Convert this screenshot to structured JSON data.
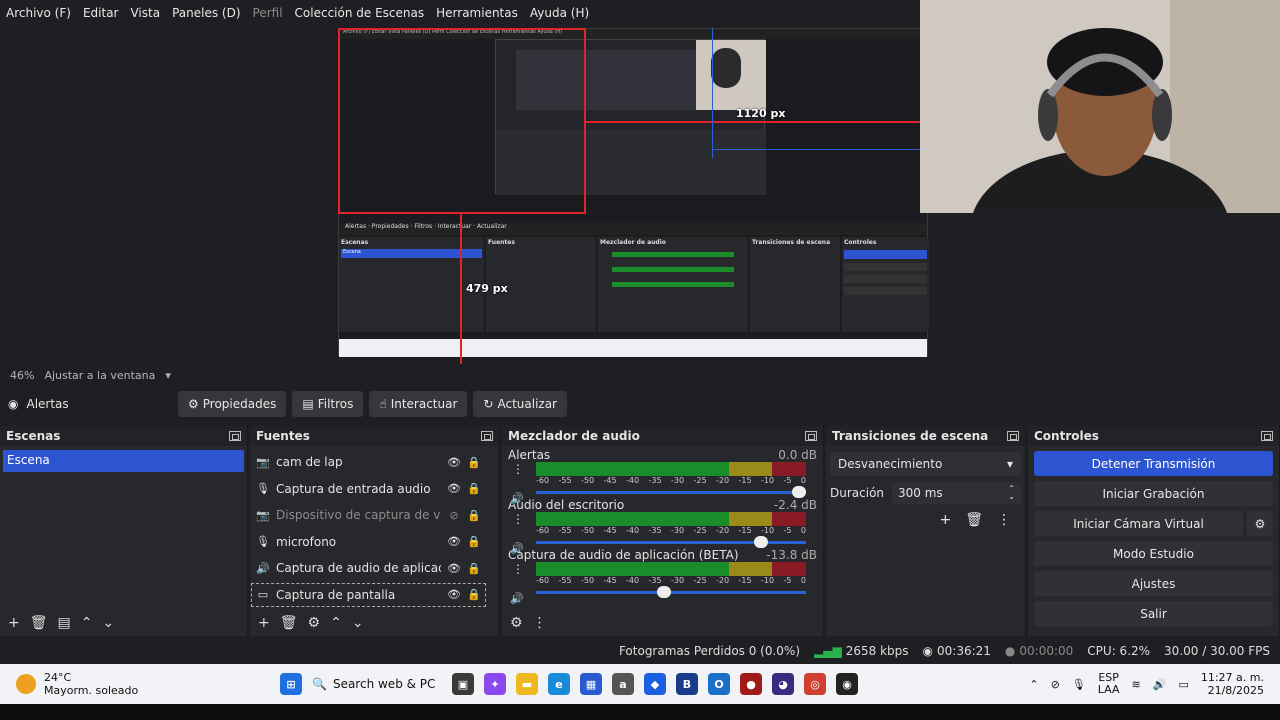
{
  "menu": [
    "Archivo (F)",
    "Editar",
    "Vista",
    "Paneles (D)",
    "Perfil",
    "Colección de Escenas",
    "Herramientas",
    "Ayuda (H)"
  ],
  "menu_disabled": [
    "Perfil"
  ],
  "preview": {
    "measure_h": "1120 px",
    "measure_v": "479 px"
  },
  "zoom": {
    "percent": "46%",
    "label": "Ajustar a la ventana"
  },
  "source_toolbar": {
    "source_name": "Alertas",
    "properties": "Propiedades",
    "filters": "Filtros",
    "interact": "Interactuar",
    "refresh": "Actualizar"
  },
  "scenes": {
    "title": "Escenas",
    "items": [
      "Escena"
    ]
  },
  "sources": {
    "title": "Fuentes",
    "items": [
      {
        "name": "cam de lap",
        "icon": "camera-icon",
        "visible": true
      },
      {
        "name": "Captura de entrada audio",
        "icon": "microphone-icon",
        "visible": true
      },
      {
        "name": "Dispositivo de captura de video",
        "icon": "camera-icon",
        "visible": false
      },
      {
        "name": "microfono",
        "icon": "microphone-icon",
        "visible": true
      },
      {
        "name": "Captura de audio de aplicación (BETA)",
        "icon": "speaker-icon",
        "visible": true
      },
      {
        "name": "Captura de pantalla",
        "icon": "monitor-icon",
        "visible": true
      }
    ]
  },
  "mixer": {
    "title": "Mezclador de audio",
    "ticks": [
      "-60",
      "-55",
      "-50",
      "-45",
      "-40",
      "-35",
      "-30",
      "-25",
      "-20",
      "-15",
      "-10",
      "-5",
      "0"
    ],
    "channels": [
      {
        "name": "Alertas",
        "db": "0.0 dB",
        "volume": 1.0
      },
      {
        "name": "Audio del escritorio",
        "db": "-2.4 dB",
        "volume": 0.86
      },
      {
        "name": "Captura de audio de aplicación (BETA)",
        "db": "-13.8 dB",
        "volume": 0.5
      }
    ]
  },
  "transitions": {
    "title": "Transiciones de escena",
    "selected": "Desvanecimiento",
    "duration_label": "Duración",
    "duration_value": "300 ms"
  },
  "controls": {
    "title": "Controles",
    "stop_stream": "Detener Transmisión",
    "start_recording": "Iniciar Grabación",
    "start_virtual_cam": "Iniciar Cámara Virtual",
    "studio_mode": "Modo Estudio",
    "settings": "Ajustes",
    "exit": "Salir"
  },
  "status": {
    "dropped_frames": "Fotogramas Perdidos 0 (0.0%)",
    "bitrate": "2658 kbps",
    "stream_time": "00:36:21",
    "rec_time": "00:00:00",
    "cpu": "CPU: 6.2%",
    "fps": "30.00 / 30.00 FPS"
  },
  "taskbar": {
    "weather_temp": "24°C",
    "weather_desc": "Mayorm. soleado",
    "search": "Search web & PC",
    "lang_top": "ESP",
    "lang_bottom": "LAA",
    "time": "11:27 a. m.",
    "date": "21/8/2025"
  },
  "colors": {
    "accent": "#2e55d1",
    "red": "#e0242b",
    "meter_green": "#1a8c2a"
  }
}
